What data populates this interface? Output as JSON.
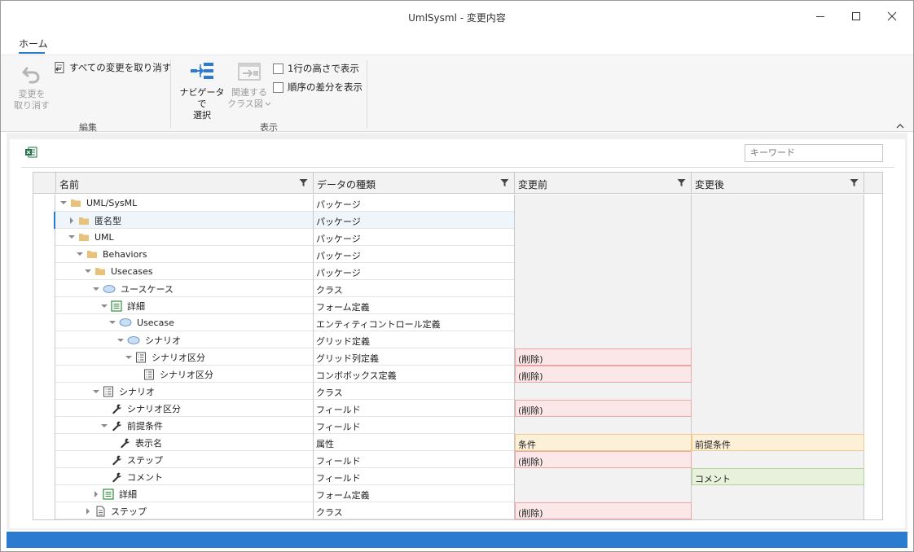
{
  "window": {
    "title": "UmlSysml - 変更内容"
  },
  "ribbon": {
    "tab": "ホーム",
    "undo_label_1": "変更を",
    "undo_label_2": "取り消す",
    "undo_all_label": "すべての変更を取り消す",
    "group_edit": "編集",
    "nav_label_1": "ナビゲータで",
    "nav_label_2": "選択",
    "related_label_1": "関連する",
    "related_label_2": "クラス図",
    "one_line_label": "1行の高さで表示",
    "order_diff_label": "順序の差分を表示",
    "group_view": "表示"
  },
  "search": {
    "placeholder": "キーワード"
  },
  "grid": {
    "columns": [
      "名前",
      "データの種類",
      "変更前",
      "変更後"
    ],
    "rows": [
      {
        "name": "UML/SysML",
        "type": "パッケージ",
        "before": "",
        "after": "",
        "before_state": "",
        "after_state": "",
        "icon": "folder-icon",
        "toggle": "expanded"
      },
      {
        "name": "匿名型",
        "type": "パッケージ",
        "before": "",
        "after": "",
        "before_state": "",
        "after_state": "",
        "icon": "folder-icon",
        "toggle": "collapsed"
      },
      {
        "name": "UML",
        "type": "パッケージ",
        "before": "",
        "after": "",
        "before_state": "",
        "after_state": "",
        "icon": "folder-icon",
        "toggle": "expanded"
      },
      {
        "name": "Behaviors",
        "type": "パッケージ",
        "before": "",
        "after": "",
        "before_state": "",
        "after_state": "",
        "icon": "folder-icon",
        "toggle": "expanded"
      },
      {
        "name": "Usecases",
        "type": "パッケージ",
        "before": "",
        "after": "",
        "before_state": "",
        "after_state": "",
        "icon": "folder-icon",
        "toggle": "expanded"
      },
      {
        "name": "ユースケース",
        "type": "クラス",
        "before": "",
        "after": "",
        "before_state": "",
        "after_state": "",
        "icon": "ellipse-icon",
        "toggle": "expanded"
      },
      {
        "name": "詳細",
        "type": "フォーム定義",
        "before": "",
        "after": "",
        "before_state": "",
        "after_state": "",
        "icon": "form-icon",
        "toggle": "expanded"
      },
      {
        "name": "Usecase",
        "type": "エンティティコントロール定義",
        "before": "",
        "after": "",
        "before_state": "",
        "after_state": "",
        "icon": "ellipse-icon",
        "toggle": "expanded"
      },
      {
        "name": "シナリオ",
        "type": "グリッド定義",
        "before": "",
        "after": "",
        "before_state": "",
        "after_state": "",
        "icon": "ellipse-icon",
        "toggle": "expanded"
      },
      {
        "name": "シナリオ区分",
        "type": "グリッド列定義",
        "before": "(削除)",
        "after": "",
        "before_state": "del",
        "after_state": "",
        "icon": "list-icon",
        "toggle": "expanded"
      },
      {
        "name": "シナリオ区分",
        "type": "コンボボックス定義",
        "before": "(削除)",
        "after": "",
        "before_state": "del",
        "after_state": "",
        "icon": "list-icon",
        "toggle": "none"
      },
      {
        "name": "シナリオ",
        "type": "クラス",
        "before": "",
        "after": "",
        "before_state": "",
        "after_state": "",
        "icon": "list-icon",
        "toggle": "expanded"
      },
      {
        "name": "シナリオ区分",
        "type": "フィールド",
        "before": "(削除)",
        "after": "",
        "before_state": "del",
        "after_state": "",
        "icon": "wrench-icon",
        "toggle": "none"
      },
      {
        "name": "前提条件",
        "type": "フィールド",
        "before": "",
        "after": "",
        "before_state": "",
        "after_state": "",
        "icon": "wrench-icon",
        "toggle": "expanded"
      },
      {
        "name": "表示名",
        "type": "属性",
        "before": "条件",
        "after": "前提条件",
        "before_state": "mod",
        "after_state": "mod",
        "icon": "wrench-icon",
        "toggle": "none"
      },
      {
        "name": "ステップ",
        "type": "フィールド",
        "before": "(削除)",
        "after": "",
        "before_state": "del",
        "after_state": "",
        "icon": "wrench-icon",
        "toggle": "none"
      },
      {
        "name": "コメント",
        "type": "フィールド",
        "before": "",
        "after": "コメント",
        "before_state": "",
        "after_state": "add",
        "icon": "wrench-icon",
        "toggle": "none"
      },
      {
        "name": "詳細",
        "type": "フォーム定義",
        "before": "",
        "after": "",
        "before_state": "",
        "after_state": "",
        "icon": "form-icon",
        "toggle": "collapsed"
      },
      {
        "name": "ステップ",
        "type": "クラス",
        "before": "(削除)",
        "after": "",
        "before_state": "del",
        "after_state": "",
        "icon": "document-icon",
        "toggle": "collapsed"
      }
    ]
  }
}
